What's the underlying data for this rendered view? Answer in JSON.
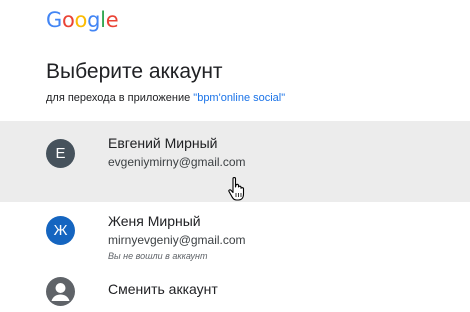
{
  "brand": {
    "logo_letters": [
      "G",
      "o",
      "o",
      "g",
      "l",
      "e"
    ],
    "logo_colors": [
      "#4285f4",
      "#ea4335",
      "#fbbc05",
      "#4285f4",
      "#34a853",
      "#ea4335"
    ]
  },
  "header": {
    "title": "Выберите аккаунт",
    "subtitle_prefix": "для перехода в приложение ",
    "app_name": "\"bpm'online social\""
  },
  "accounts": [
    {
      "initial": "E",
      "name": "Евгений Мирный",
      "email": "evgeniymirny@gmail.com",
      "avatar_color": "#46525c"
    },
    {
      "initial": "Ж",
      "name": "Женя Мирный",
      "email": "mirnyevgeniy@gmail.com",
      "note": "Вы не вошли в аккаунт",
      "avatar_color": "#1565c0"
    }
  ],
  "switch_account": {
    "label": "Сменить аккаунт",
    "icon": "account-circle-icon"
  },
  "cursor": {
    "icon": "hand-pointer-icon"
  }
}
